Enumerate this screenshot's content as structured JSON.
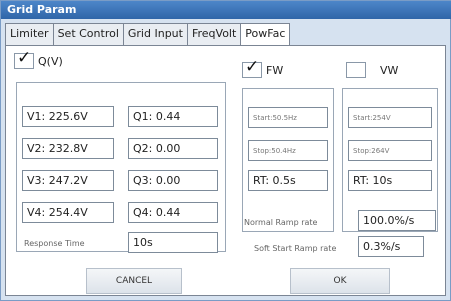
{
  "window": {
    "title": "Grid Param"
  },
  "tabs": [
    {
      "label": "Limiter"
    },
    {
      "label": "Set Control"
    },
    {
      "label": "Grid Input"
    },
    {
      "label": "FreqVolt"
    },
    {
      "label": "PowFac"
    }
  ],
  "checkboxes": {
    "qv": {
      "label": "Q(V)",
      "checked": true
    },
    "fw": {
      "label": "FW",
      "checked": true
    },
    "vw": {
      "label": "VW",
      "checked": false
    }
  },
  "qv_points": [
    {
      "v": "V1: 225.6V",
      "q": "Q1: 0.44"
    },
    {
      "v": "V2: 232.8V",
      "q": "Q2: 0.00"
    },
    {
      "v": "V3: 247.2V",
      "q": "Q3: 0.00"
    },
    {
      "v": "V4: 254.4V",
      "q": "Q4: 0.44"
    }
  ],
  "response_time": {
    "label": "Response Time",
    "value": "10s"
  },
  "fw": {
    "start": "Start:50.5Hz",
    "stop": "Stop:50.4Hz",
    "rt": "RT: 0.5s"
  },
  "vw": {
    "start": "Start:254V",
    "stop": "Stop:264V",
    "rt": "RT: 10s"
  },
  "normal_ramp": {
    "label": "Normal Ramp rate",
    "value": "100.0%/s"
  },
  "soft_start": {
    "label": "Soft Start Ramp rate",
    "value": "0.3%/s"
  },
  "buttons": {
    "cancel": "CANCEL",
    "ok": "OK"
  }
}
